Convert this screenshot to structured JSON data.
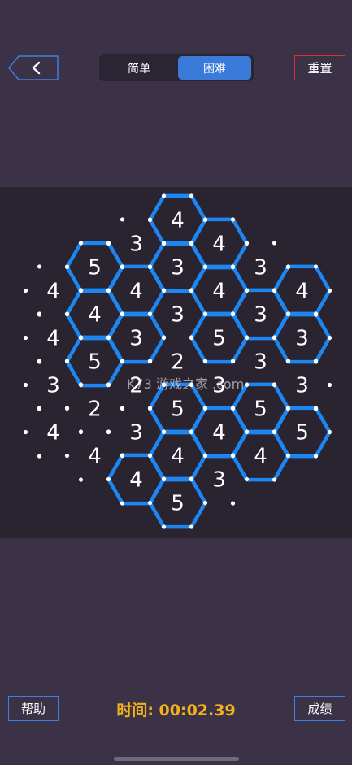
{
  "header": {
    "back_icon": "chevron-left-icon",
    "modes": [
      {
        "label": "简单",
        "active": false
      },
      {
        "label": "困难",
        "active": true
      }
    ],
    "reset_label": "重置"
  },
  "board": {
    "clues": [
      {
        "col": 4,
        "row": 0,
        "n": 4
      },
      {
        "col": 3,
        "row": 1,
        "n": 3
      },
      {
        "col": 5,
        "row": 1,
        "n": 4
      },
      {
        "col": 2,
        "row": 2,
        "n": 5
      },
      {
        "col": 4,
        "row": 2,
        "n": 3
      },
      {
        "col": 6,
        "row": 2,
        "n": 3
      },
      {
        "col": 1,
        "row": 3,
        "n": 4
      },
      {
        "col": 3,
        "row": 3,
        "n": 4
      },
      {
        "col": 5,
        "row": 3,
        "n": 4
      },
      {
        "col": 7,
        "row": 3,
        "n": 4
      },
      {
        "col": 2,
        "row": 4,
        "n": 4
      },
      {
        "col": 4,
        "row": 4,
        "n": 3
      },
      {
        "col": 6,
        "row": 4,
        "n": 3
      },
      {
        "col": 1,
        "row": 5,
        "n": 4
      },
      {
        "col": 3,
        "row": 5,
        "n": 3
      },
      {
        "col": 5,
        "row": 5,
        "n": 5
      },
      {
        "col": 7,
        "row": 5,
        "n": 3
      },
      {
        "col": 2,
        "row": 6,
        "n": 5
      },
      {
        "col": 4,
        "row": 6,
        "n": 2
      },
      {
        "col": 6,
        "row": 6,
        "n": 3
      },
      {
        "col": 1,
        "row": 7,
        "n": 3
      },
      {
        "col": 3,
        "row": 7,
        "n": 2
      },
      {
        "col": 5,
        "row": 7,
        "n": 3
      },
      {
        "col": 7,
        "row": 7,
        "n": 3
      },
      {
        "col": 2,
        "row": 8,
        "n": 2
      },
      {
        "col": 4,
        "row": 8,
        "n": 5
      },
      {
        "col": 6,
        "row": 8,
        "n": 5
      },
      {
        "col": 1,
        "row": 9,
        "n": 4
      },
      {
        "col": 3,
        "row": 9,
        "n": 3
      },
      {
        "col": 5,
        "row": 9,
        "n": 4
      },
      {
        "col": 7,
        "row": 9,
        "n": 5
      },
      {
        "col": 2,
        "row": 10,
        "n": 4
      },
      {
        "col": 4,
        "row": 10,
        "n": 4
      },
      {
        "col": 6,
        "row": 10,
        "n": 4
      },
      {
        "col": 3,
        "row": 11,
        "n": 4
      },
      {
        "col": 5,
        "row": 11,
        "n": 3
      },
      {
        "col": 4,
        "row": 12,
        "n": 5
      }
    ],
    "loop_cells": [
      {
        "col": 4,
        "row": 0
      },
      {
        "col": 5,
        "row": 1
      },
      {
        "col": 4,
        "row": 2
      },
      {
        "col": 2,
        "row": 2
      },
      {
        "col": 3,
        "row": 3
      },
      {
        "col": 2,
        "row": 4
      },
      {
        "col": 5,
        "row": 3
      },
      {
        "col": 5,
        "row": 5
      },
      {
        "col": 6,
        "row": 4
      },
      {
        "col": 7,
        "row": 3
      },
      {
        "col": 7,
        "row": 5
      },
      {
        "col": 2,
        "row": 6
      },
      {
        "col": 3,
        "row": 5
      },
      {
        "col": 4,
        "row": 8
      },
      {
        "col": 4,
        "row": 10
      },
      {
        "col": 5,
        "row": 9
      },
      {
        "col": 6,
        "row": 8
      },
      {
        "col": 7,
        "row": 9
      },
      {
        "col": 6,
        "row": 10
      },
      {
        "col": 3,
        "row": 11
      },
      {
        "col": 4,
        "row": 12
      }
    ],
    "loop_color": "#1c86f2",
    "dot_color": "#ffffff",
    "watermark": "K73 游戏之家 .com"
  },
  "footer": {
    "help_label": "帮助",
    "timer": "时间: 00:02.39",
    "score_label": "成绩",
    "timer_color": "#f2b01b"
  }
}
